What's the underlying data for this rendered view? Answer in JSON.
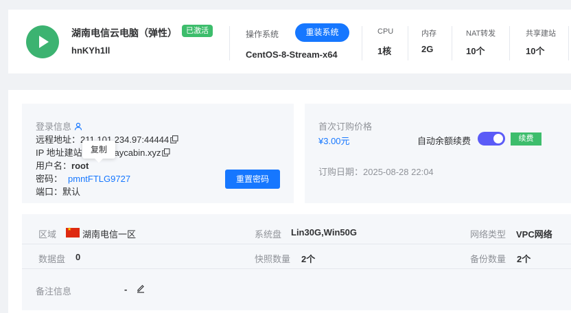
{
  "header": {
    "name": "湖南电信云电脑（弹性）",
    "status_badge": "已激活",
    "instance_id": "hnKYh1ll",
    "os_label": "操作系统",
    "reinstall_label": "重装系统",
    "os_value": "CentOS-8-Stream-x64",
    "specs": [
      {
        "label": "CPU",
        "value": "1核"
      },
      {
        "label": "内存",
        "value": "2G"
      },
      {
        "label": "NAT转发",
        "value": "10个"
      },
      {
        "label": "共享建站",
        "value": "10个"
      }
    ]
  },
  "login": {
    "title": "登录信息",
    "remote_label": "远程地址：",
    "remote_value": "211.101.234.97:44444",
    "ip_label": "IP 地址建站",
    "ip_value": "jaycabin.xyz",
    "username_label": "用户名：",
    "username_value": "root",
    "password_label": "密码：",
    "password_value": "pmntFTLG9727",
    "port_label": "端口：",
    "port_value": "默认",
    "reset_label": "重置密码",
    "tooltip": "复制"
  },
  "order": {
    "price_label": "首次订购价格",
    "price_value": "¥3.00元",
    "auto_renew_label": "自动余额续费",
    "auto_renew_on": true,
    "renew_label": "续费",
    "date_label": "订购日期：",
    "date_value": "2025-08-28 22:04"
  },
  "details": {
    "region_label": "区域",
    "region_value": "湖南电信一区",
    "sysdisk_label": "系统盘",
    "sysdisk_value": "Lin30G,Win50G",
    "nettype_label": "网络类型",
    "nettype_value": "VPC网络",
    "datadisk_label": "数据盘",
    "datadisk_value": "0",
    "snapshot_label": "快照数量",
    "snapshot_value": "2个",
    "backup_label": "备份数量",
    "backup_value": "2个",
    "remark_label": "备注信息",
    "remark_value": "-"
  },
  "colors": {
    "primary": "#1677ff",
    "success": "#3dbd6c",
    "toggle": "#5b5bf7"
  }
}
